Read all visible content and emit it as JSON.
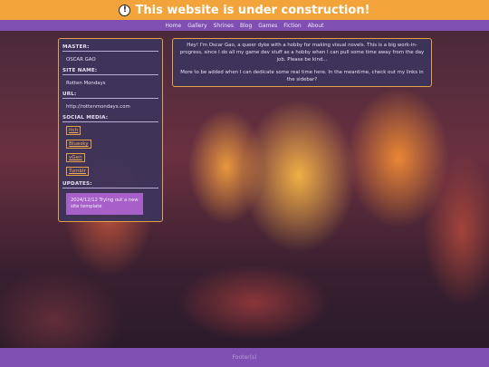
{
  "header": {
    "warning_icon": "warning-icon",
    "title": "This website is under construction!",
    "bg_color": "#f2a43a"
  },
  "nav": {
    "items": [
      "Home",
      "Gallery",
      "Shrines",
      "Blog",
      "Games",
      "Fiction",
      "About"
    ],
    "bg_color": "#7f4fb2"
  },
  "sidebar": {
    "master_label": "MASTER:",
    "master_value": "OSCAR GAO",
    "site_name_label": "SITE NAME:",
    "site_name_value": "Rotten Mondays",
    "url_label": "URL:",
    "url_value": "http://rottenmondays.com",
    "social_label": "SOCIAL MEDIA:",
    "social_links": [
      "itch",
      "Bluesky",
      "vGen",
      "Tumblr"
    ],
    "updates_label": "UPDATES:",
    "update_text": "2024/12/12 Trying out a new site template"
  },
  "main": {
    "paragraph1": "Hey! I'm Oscar Gao, a queer dyke with a hobby for making visual novels. This is a big work-in-progress, since I do all my game dev stuff as a hobby when I can pull some time away from the day job. Please be kind...",
    "paragraph2": "More to be added when I can dedicate some real time here. In the meantime, check out my links in the sidebar?"
  },
  "footer": {
    "text": "Footer(s)"
  },
  "colors": {
    "accent": "#e4a047",
    "panel": "#3c345a",
    "update_bg": "#a760c8"
  }
}
